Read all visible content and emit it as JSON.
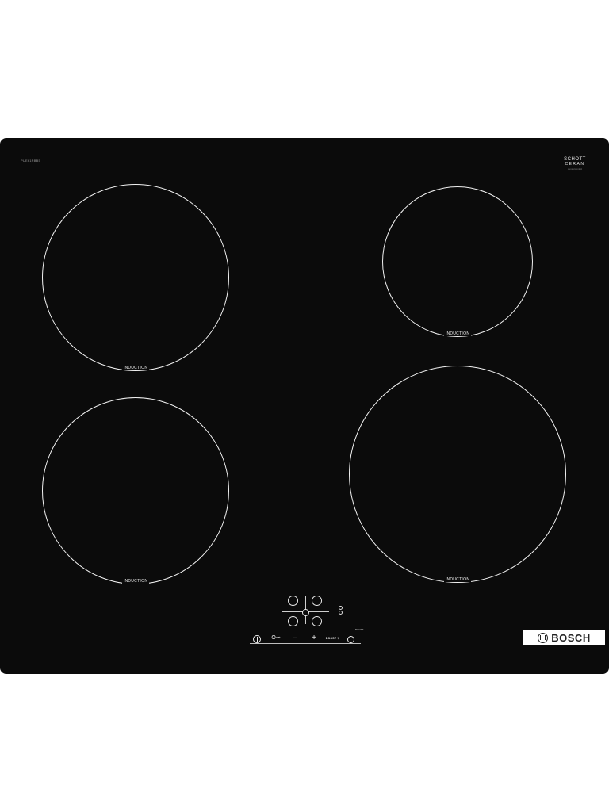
{
  "product": {
    "model_code": "PUE61RBB5",
    "glass_brand": {
      "line1": "SCHOTT",
      "line2": "CERAN",
      "line3": "sensorcontrol"
    },
    "zones": [
      {
        "id": "rear-left",
        "label": "INDUCTION"
      },
      {
        "id": "rear-right",
        "label": "INDUCTION"
      },
      {
        "id": "front-left",
        "label": "INDUCTION"
      },
      {
        "id": "front-right",
        "label": "INDUCTION"
      }
    ],
    "controls": {
      "lock_label": "O⊸",
      "minus_label": "–",
      "plus_label": "+",
      "boost_label": "BOOST ⌇",
      "boost_tag": "BOOST"
    },
    "brand": "BOSCH",
    "colors": {
      "glass": "#0b0b0b",
      "markings": "#f2f2f2",
      "plate": "#ffffff"
    }
  }
}
